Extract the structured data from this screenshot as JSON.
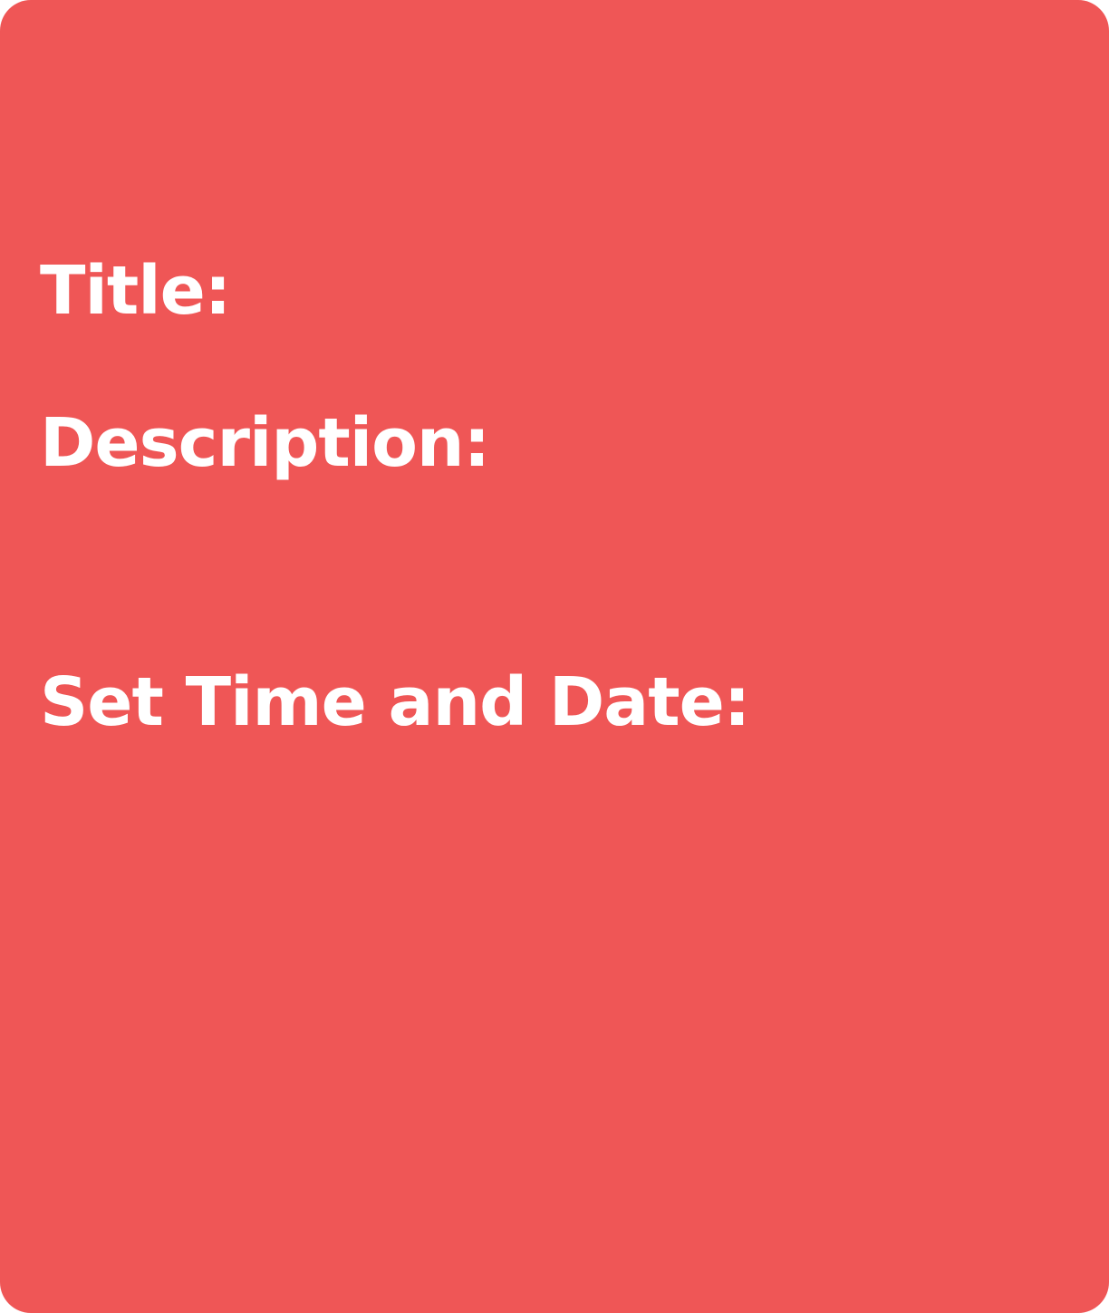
{
  "form": {
    "title_label": "Title:",
    "description_label": "Description:",
    "datetime_label": "Set Time and Date:"
  },
  "colors": {
    "card_background": "#EF5656",
    "text": "#FFFFFF"
  }
}
